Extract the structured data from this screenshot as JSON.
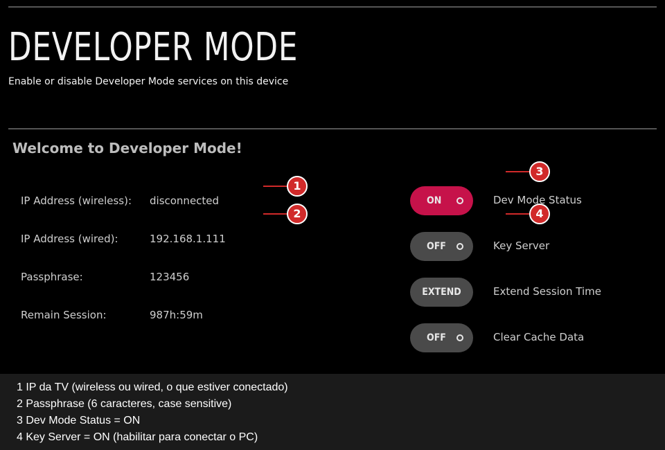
{
  "header": {
    "title": "DEVELOPER MODE",
    "subtitle": "Enable or disable Developer Mode services on this device"
  },
  "main": {
    "welcome": "Welcome to Developer Mode!",
    "info": [
      {
        "label": "IP Address (wireless):",
        "value": "disconnected"
      },
      {
        "label": "IP Address (wired):",
        "value": "192.168.1.111"
      },
      {
        "label": "Passphrase:",
        "value": "123456"
      },
      {
        "label": "Remain Session:",
        "value": "987h:59m"
      }
    ],
    "toggles": [
      {
        "state": "ON",
        "caption": "Dev Mode Status",
        "active": true
      },
      {
        "state": "OFF",
        "caption": "Key Server",
        "active": false
      },
      {
        "state": "EXTEND",
        "caption": "Extend Session Time",
        "active": false
      },
      {
        "state": "OFF",
        "caption": "Clear Cache Data",
        "active": false
      }
    ]
  },
  "annotations": {
    "markers": [
      "1",
      "2",
      "3",
      "4"
    ],
    "notes": [
      "1 IP da TV (wireless ou wired, o que estiver conectado)",
      "2 Passphrase (6 caracteres, case sensitive)",
      "3 Dev Mode Status = ON",
      "4 Key Server = ON (habilitar para conectar o PC)"
    ]
  },
  "colors": {
    "background": "#000000",
    "accent_on": "#c6124a",
    "toggle_off": "#4a4a4a",
    "annotation_red": "#d12a2a",
    "notes_background": "#1b1b1b"
  }
}
